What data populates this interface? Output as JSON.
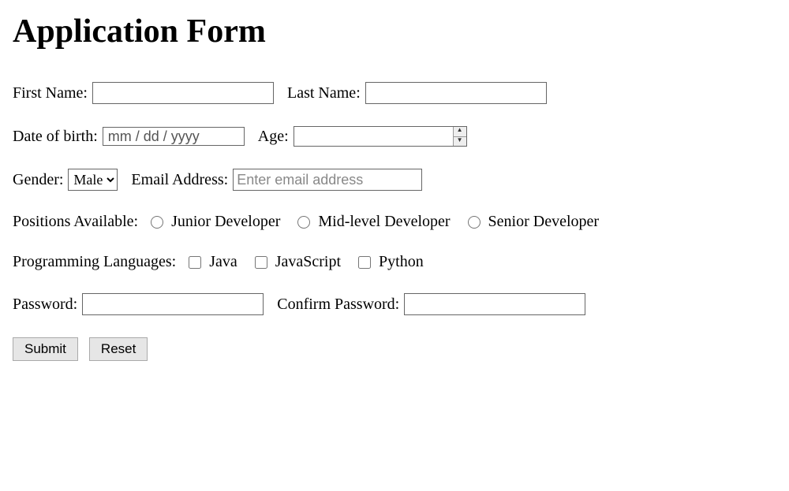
{
  "title": "Application Form",
  "fields": {
    "first_name_label": "First Name:",
    "last_name_label": "Last Name:",
    "dob_label": "Date of birth:",
    "dob_placeholder": "mm / dd / yyyy",
    "age_label": "Age:",
    "gender_label": "Gender:",
    "gender_selected": "Male",
    "email_label": "Email Address:",
    "email_placeholder": "Enter email address",
    "positions_label": "Positions Available:",
    "positions": {
      "junior": "Junior Developer",
      "mid": "Mid-level Developer",
      "senior": "Senior Developer"
    },
    "languages_label": "Programming Languages:",
    "languages": {
      "java": "Java",
      "javascript": "JavaScript",
      "python": "Python"
    },
    "password_label": "Password:",
    "confirm_password_label": "Confirm Password:"
  },
  "buttons": {
    "submit": "Submit",
    "reset": "Reset"
  }
}
